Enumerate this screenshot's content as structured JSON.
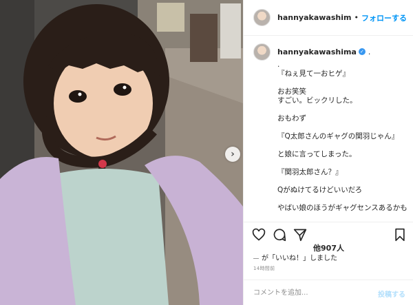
{
  "post": {
    "account": "hannyakawashima",
    "header_username": "hannyakawashim",
    "follow_label": "フォローする",
    "header_separator": "•",
    "caption_username": "hannyakawashima",
    "caption_trail": ".",
    "caption_lines": [
      ".",
      "『ねぇ見て一おヒゲ』",
      "",
      "おお笑笑",
      "すごい。ビックリした。",
      "",
      "おもわず",
      "",
      "『Q太郎さんのギャグの関羽じゃん』",
      "",
      "と娘に言ってしまった。",
      "",
      "『関羽太郎さん？』",
      "",
      "Qがぬけてるけどいいだろ",
      "",
      "やばい娘のほうがギャグセンスあるかも"
    ],
    "likes_text": "他907人",
    "liked_by_text": "が「いいね！」しました",
    "timestamp": "14時間前",
    "comment_placeholder": "コメントを追加...",
    "post_button": "投稿する"
  },
  "icons": {
    "like": "heart-icon",
    "comment": "comment-icon",
    "share": "paper-plane-icon",
    "save": "bookmark-icon",
    "next": "chevron-right-icon",
    "verified": "verified-badge-icon"
  },
  "colors": {
    "link_blue": "#0095f6",
    "verified_blue": "#3897f0",
    "muted": "#8e8e8e",
    "post_button_disabled": "#b2dffc"
  }
}
